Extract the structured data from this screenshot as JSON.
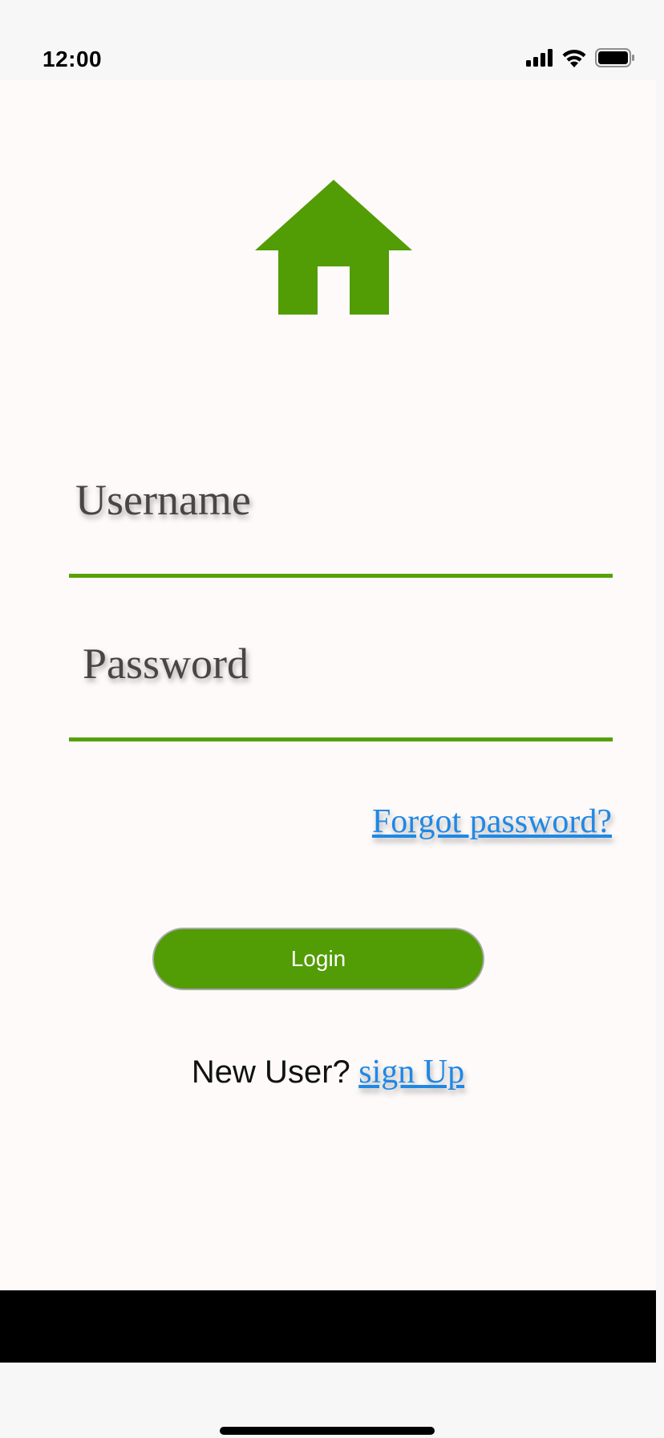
{
  "status_bar": {
    "time": "12:00",
    "icons": [
      "cellular-signal-icon",
      "wifi-icon",
      "battery-icon"
    ]
  },
  "logo": {
    "icon": "home-icon",
    "color": "#529c05"
  },
  "form": {
    "username_placeholder": "Username",
    "password_placeholder": "Password",
    "forgot_password_link": "Forgot password?",
    "login_button": "Login"
  },
  "signup": {
    "prompt": "New User?",
    "link": "sign Up"
  },
  "colors": {
    "accent": "#529c05",
    "link": "#1f88e4",
    "screen_background": "#fdfaf9"
  }
}
